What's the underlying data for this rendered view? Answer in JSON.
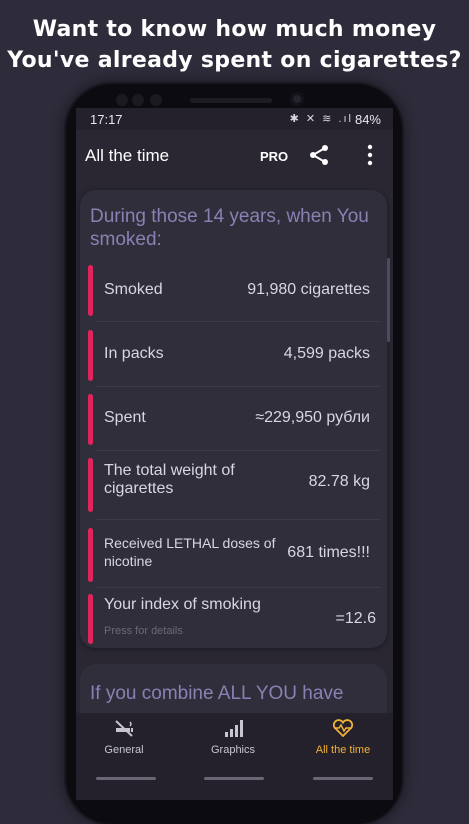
{
  "promo": {
    "line1": "Want to know how much money",
    "line2": "You've already spent on cigarettes?"
  },
  "status_bar": {
    "time": "17:17",
    "icons": "✱ ✕ ≋ .ıl",
    "battery": "84%"
  },
  "app_bar": {
    "title": "All the time",
    "pro_label": "PRO",
    "share_icon": "share-icon",
    "more_icon": "more-vert-icon"
  },
  "stats_card": {
    "heading": "During those 14 years, when You smoked:",
    "accent_color": "#e0245e",
    "rows": [
      {
        "label": "Smoked",
        "value": "91,980 cigarettes"
      },
      {
        "label": "In packs",
        "value": "4,599 packs"
      },
      {
        "label": "Spent",
        "value": "≈229,950 рубли"
      },
      {
        "label": "The total weight of cigarettes",
        "value": "82.78 kg"
      },
      {
        "label": "Received LETHAL doses of nicotine",
        "value": "681 times!!!"
      },
      {
        "label": "Your index of smoking",
        "value": "=12.6",
        "sub": "Press for details"
      }
    ]
  },
  "next_card": {
    "heading": "If you combine ALL YOU have"
  },
  "bottom_nav": {
    "active_color": "#f2b233",
    "items": [
      {
        "label": "General",
        "icon": "no-smoking-icon",
        "active": false
      },
      {
        "label": "Graphics",
        "icon": "bar-chart-icon",
        "active": false
      },
      {
        "label": "All the time",
        "icon": "heart-pulse-icon",
        "active": true
      }
    ]
  }
}
